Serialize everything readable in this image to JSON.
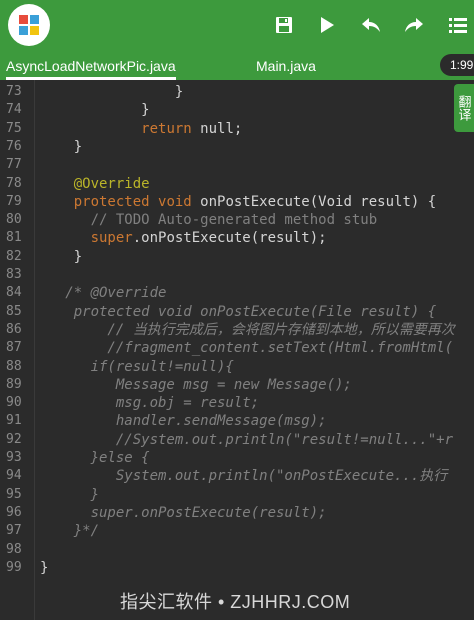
{
  "tabs": [
    {
      "label": "AsyncLoadNetworkPic.java",
      "active": true
    },
    {
      "label": "Main.java",
      "active": false
    }
  ],
  "time_pill": "1:99",
  "side_tab": "翻译",
  "lines": [
    {
      "n": "73",
      "segs": [
        {
          "t": "                }",
          "c": "plain"
        }
      ]
    },
    {
      "n": "74",
      "segs": [
        {
          "t": "            }",
          "c": "plain"
        }
      ]
    },
    {
      "n": "75",
      "segs": [
        {
          "t": "            ",
          "c": "plain"
        },
        {
          "t": "return",
          "c": "kw"
        },
        {
          "t": " null;",
          "c": "plain"
        }
      ]
    },
    {
      "n": "76",
      "segs": [
        {
          "t": "    }",
          "c": "plain"
        }
      ]
    },
    {
      "n": "77",
      "segs": [
        {
          "t": "",
          "c": "plain"
        }
      ]
    },
    {
      "n": "78",
      "segs": [
        {
          "t": "    ",
          "c": "plain"
        },
        {
          "t": "@Override",
          "c": "ann"
        }
      ]
    },
    {
      "n": "79",
      "segs": [
        {
          "t": "    ",
          "c": "plain"
        },
        {
          "t": "protected",
          "c": "kw"
        },
        {
          "t": " ",
          "c": "plain"
        },
        {
          "t": "void",
          "c": "kw"
        },
        {
          "t": " onPostExecute(Void result) {",
          "c": "plain"
        }
      ]
    },
    {
      "n": "80",
      "segs": [
        {
          "t": "      // TODO Auto-generated method stub",
          "c": "cm"
        }
      ]
    },
    {
      "n": "81",
      "segs": [
        {
          "t": "      ",
          "c": "plain"
        },
        {
          "t": "super",
          "c": "kw"
        },
        {
          "t": ".onPostExecute(result);",
          "c": "plain"
        }
      ]
    },
    {
      "n": "82",
      "segs": [
        {
          "t": "    }",
          "c": "plain"
        }
      ]
    },
    {
      "n": "83",
      "segs": [
        {
          "t": "",
          "c": "plain"
        }
      ]
    },
    {
      "n": "84",
      "segs": [
        {
          "t": "   /* @Override",
          "c": "cm-it"
        }
      ]
    },
    {
      "n": "85",
      "segs": [
        {
          "t": "    protected void onPostExecute(File result) {",
          "c": "cm-it"
        }
      ]
    },
    {
      "n": "86",
      "segs": [
        {
          "t": "        // 当执行完成后，会将图片存储到本地，所以需要再次",
          "c": "cm-it"
        }
      ]
    },
    {
      "n": "87",
      "segs": [
        {
          "t": "        //fragment_content.setText(Html.fromHtml(",
          "c": "cm-it"
        }
      ]
    },
    {
      "n": "88",
      "segs": [
        {
          "t": "      if(result!=null){",
          "c": "cm-it"
        }
      ]
    },
    {
      "n": "89",
      "segs": [
        {
          "t": "         Message msg = new Message();",
          "c": "cm-it"
        }
      ]
    },
    {
      "n": "90",
      "segs": [
        {
          "t": "         msg.obj = result;",
          "c": "cm-it"
        }
      ]
    },
    {
      "n": "91",
      "segs": [
        {
          "t": "         handler.sendMessage(msg);",
          "c": "cm-it"
        }
      ]
    },
    {
      "n": "92",
      "segs": [
        {
          "t": "         //System.out.println(\"result!=null...\"+r",
          "c": "cm-it"
        }
      ]
    },
    {
      "n": "93",
      "segs": [
        {
          "t": "      }else {",
          "c": "cm-it"
        }
      ]
    },
    {
      "n": "94",
      "segs": [
        {
          "t": "         System.out.println(\"onPostExecute...执行",
          "c": "cm-it"
        }
      ]
    },
    {
      "n": "95",
      "segs": [
        {
          "t": "      }",
          "c": "cm-it"
        }
      ]
    },
    {
      "n": "96",
      "segs": [
        {
          "t": "      super.onPostExecute(result);",
          "c": "cm-it"
        }
      ]
    },
    {
      "n": "97",
      "segs": [
        {
          "t": "    }*/",
          "c": "cm-it"
        }
      ]
    },
    {
      "n": "98",
      "segs": [
        {
          "t": "",
          "c": "plain"
        }
      ]
    },
    {
      "n": "99",
      "segs": [
        {
          "t": "}",
          "c": "plain"
        }
      ]
    }
  ],
  "watermark": "指尖汇软件 • ZJHHRJ.COM",
  "colors": {
    "toolbar": "#3d9a3d",
    "background": "#2b2b2b",
    "keyword": "#cc7832",
    "annotation": "#bbb529",
    "comment": "#808080"
  }
}
